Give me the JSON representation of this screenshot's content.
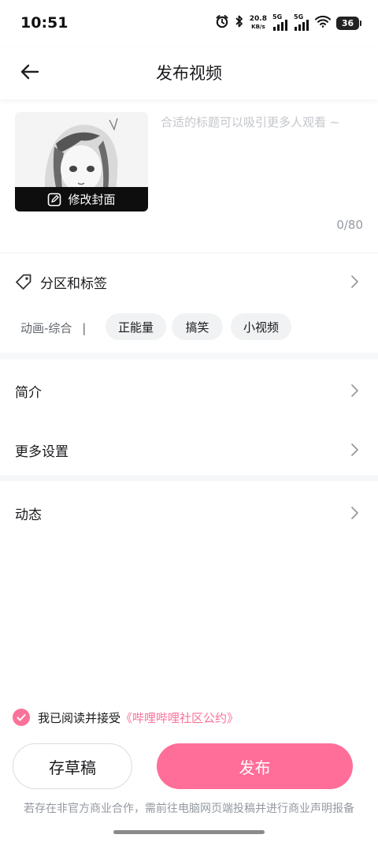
{
  "status": {
    "time": "10:51",
    "speed_value": "20.8",
    "speed_unit": "KB/s",
    "sim1": "5G",
    "sim2": "5G",
    "battery": "36"
  },
  "header": {
    "title": "发布视频"
  },
  "video": {
    "edit_cover_label": "修改封面",
    "title_placeholder": "合适的标题可以吸引更多人观看 ~",
    "title_value": "",
    "title_count": "0/80"
  },
  "partition": {
    "label": "分区和标签",
    "category": "动画-综合",
    "separator": "|",
    "tags": [
      "正能量",
      "搞笑",
      "小视频"
    ]
  },
  "menu": {
    "intro": "简介",
    "more_settings": "更多设置",
    "dynamic": "动态"
  },
  "agreement": {
    "prefix": "我已阅读并接受",
    "link": "《哔哩哔哩社区公约》",
    "checked": true
  },
  "buttons": {
    "draft": "存草稿",
    "publish": "发布"
  },
  "notice": "若存在非官方商业合作，需前往电脑网页端投稿并进行商业声明报备",
  "colors": {
    "accent": "#fb7299",
    "publish_bg": "#ff6e99",
    "text": "#18191c",
    "muted": "#9499a0"
  },
  "icons": [
    "back-arrow-icon",
    "tag-icon",
    "edit-icon",
    "chevron-right-icon",
    "check-icon",
    "alarm-icon",
    "bluetooth-icon",
    "wifi-icon"
  ]
}
